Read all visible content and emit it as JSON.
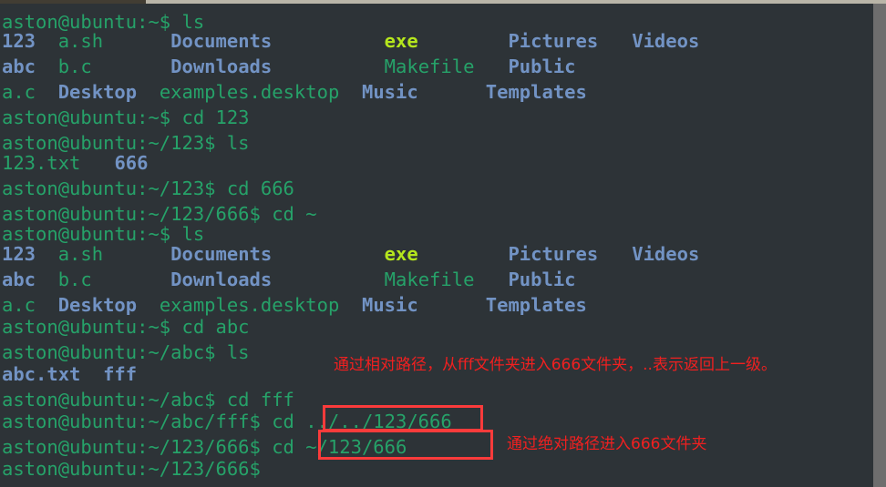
{
  "terminal": {
    "user_host": "aston@ubuntu",
    "colors": {
      "background": "#2d3337",
      "prompt_green": "#26a269",
      "directory_blue": "#7293c4",
      "executable_green": "#b5e61d",
      "annotation_red": "#f02020",
      "box_red": "#fb3b3b",
      "scrollbar_gray": "#6e6e6e"
    },
    "lines": [
      {
        "id": "l1",
        "text": "aston@ubuntu:~$ ls"
      },
      {
        "id": "l2",
        "segments": [
          {
            "text": "123",
            "kind": "dir"
          },
          {
            "text": "  ",
            "kind": "plain"
          },
          {
            "text": "a.sh",
            "kind": "file"
          },
          {
            "text": "      ",
            "kind": "plain"
          },
          {
            "text": "Documents",
            "kind": "dir"
          },
          {
            "text": "          ",
            "kind": "plain"
          },
          {
            "text": "exe",
            "kind": "exec"
          },
          {
            "text": "        ",
            "kind": "plain"
          },
          {
            "text": "Pictures",
            "kind": "dir"
          },
          {
            "text": "   ",
            "kind": "plain"
          },
          {
            "text": "Videos",
            "kind": "dir"
          }
        ]
      },
      {
        "id": "l3",
        "segments": [
          {
            "text": "abc",
            "kind": "dir"
          },
          {
            "text": "  ",
            "kind": "plain"
          },
          {
            "text": "b.c",
            "kind": "file"
          },
          {
            "text": "       ",
            "kind": "plain"
          },
          {
            "text": "Downloads",
            "kind": "dir"
          },
          {
            "text": "          ",
            "kind": "plain"
          },
          {
            "text": "Makefile",
            "kind": "file"
          },
          {
            "text": "   ",
            "kind": "plain"
          },
          {
            "text": "Public",
            "kind": "dir"
          }
        ]
      },
      {
        "id": "l4",
        "segments": [
          {
            "text": "a.c",
            "kind": "file"
          },
          {
            "text": "  ",
            "kind": "plain"
          },
          {
            "text": "Desktop",
            "kind": "dir"
          },
          {
            "text": "  ",
            "kind": "plain"
          },
          {
            "text": "examples.desktop",
            "kind": "file"
          },
          {
            "text": "  ",
            "kind": "plain"
          },
          {
            "text": "Music",
            "kind": "dir"
          },
          {
            "text": "      ",
            "kind": "plain"
          },
          {
            "text": "Templates",
            "kind": "dir"
          }
        ]
      },
      {
        "id": "l5",
        "text": "aston@ubuntu:~$ cd 123"
      },
      {
        "id": "l6",
        "text": "aston@ubuntu:~/123$ ls"
      },
      {
        "id": "l7",
        "segments": [
          {
            "text": "123.txt",
            "kind": "file"
          },
          {
            "text": "   ",
            "kind": "plain"
          },
          {
            "text": "666",
            "kind": "dir"
          }
        ]
      },
      {
        "id": "l8",
        "text": "aston@ubuntu:~/123$ cd 666"
      },
      {
        "id": "l9",
        "text": "aston@ubuntu:~/123/666$ cd ~"
      },
      {
        "id": "l10",
        "text": "aston@ubuntu:~$ ls"
      },
      {
        "id": "l11",
        "segments": [
          {
            "text": "123",
            "kind": "dir"
          },
          {
            "text": "  ",
            "kind": "plain"
          },
          {
            "text": "a.sh",
            "kind": "file"
          },
          {
            "text": "      ",
            "kind": "plain"
          },
          {
            "text": "Documents",
            "kind": "dir"
          },
          {
            "text": "          ",
            "kind": "plain"
          },
          {
            "text": "exe",
            "kind": "exec"
          },
          {
            "text": "        ",
            "kind": "plain"
          },
          {
            "text": "Pictures",
            "kind": "dir"
          },
          {
            "text": "   ",
            "kind": "plain"
          },
          {
            "text": "Videos",
            "kind": "dir"
          }
        ]
      },
      {
        "id": "l12",
        "segments": [
          {
            "text": "abc",
            "kind": "dir"
          },
          {
            "text": "  ",
            "kind": "plain"
          },
          {
            "text": "b.c",
            "kind": "file"
          },
          {
            "text": "       ",
            "kind": "plain"
          },
          {
            "text": "Downloads",
            "kind": "dir"
          },
          {
            "text": "          ",
            "kind": "plain"
          },
          {
            "text": "Makefile",
            "kind": "file"
          },
          {
            "text": "   ",
            "kind": "plain"
          },
          {
            "text": "Public",
            "kind": "dir"
          }
        ]
      },
      {
        "id": "l13",
        "segments": [
          {
            "text": "a.c",
            "kind": "file"
          },
          {
            "text": "  ",
            "kind": "plain"
          },
          {
            "text": "Desktop",
            "kind": "dir"
          },
          {
            "text": "  ",
            "kind": "plain"
          },
          {
            "text": "examples.desktop",
            "kind": "file"
          },
          {
            "text": "  ",
            "kind": "plain"
          },
          {
            "text": "Music",
            "kind": "dir"
          },
          {
            "text": "      ",
            "kind": "plain"
          },
          {
            "text": "Templates",
            "kind": "dir"
          }
        ]
      },
      {
        "id": "l14",
        "text": "aston@ubuntu:~$ cd abc"
      },
      {
        "id": "l15",
        "text": "aston@ubuntu:~/abc$ ls"
      },
      {
        "id": "l16",
        "segments": [
          {
            "text": "abc.txt",
            "kind": "dir"
          },
          {
            "text": "  ",
            "kind": "plain"
          },
          {
            "text": "fff",
            "kind": "dir"
          }
        ]
      },
      {
        "id": "l17",
        "text": "aston@ubuntu:~/abc$ cd fff"
      },
      {
        "id": "l18",
        "text": "aston@ubuntu:~/abc/fff$ cd ../../123/666"
      },
      {
        "id": "l19",
        "text": "aston@ubuntu:~/123/666$ cd ~/123/666"
      },
      {
        "id": "l20",
        "text": "aston@ubuntu:~/123/666$"
      }
    ],
    "annotations": [
      {
        "id": "a1",
        "text": "通过相对路径，从fff文件夹进入666文件夹，..表示返回上一级。"
      },
      {
        "id": "a2",
        "text": "通过绝对路径进入666文件夹"
      }
    ],
    "highlight_boxes": [
      {
        "id": "box1",
        "target": "../../123/666"
      },
      {
        "id": "box2",
        "target": "~/123/666"
      }
    ]
  }
}
